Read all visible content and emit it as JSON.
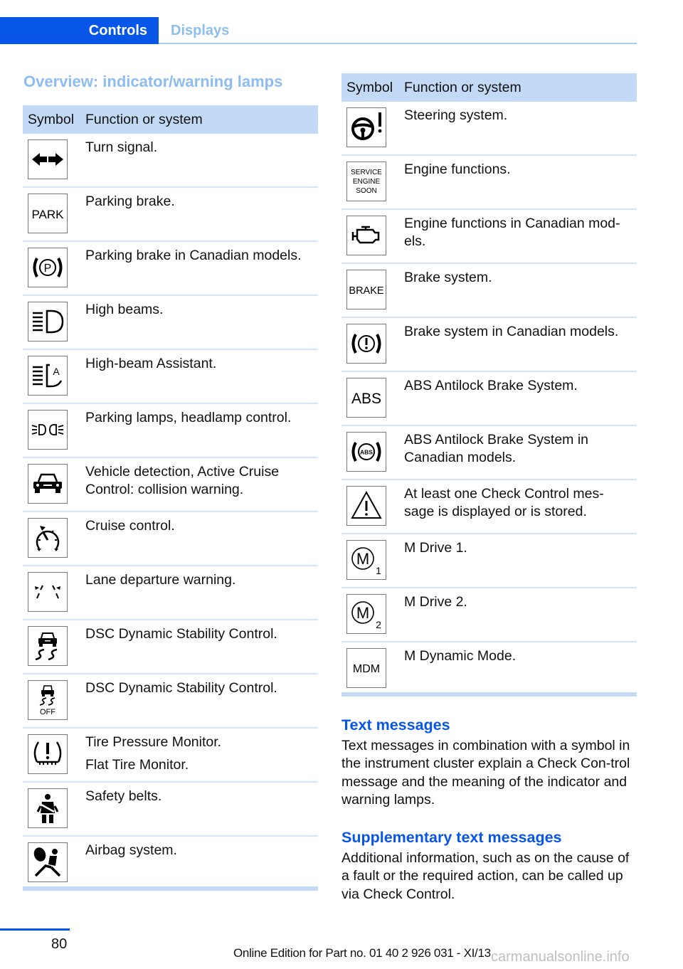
{
  "tabs": [
    {
      "label": "Controls",
      "active": true
    },
    {
      "label": "Displays",
      "active": false
    }
  ],
  "section_title": "Overview: indicator/warning lamps",
  "table_headers": {
    "symbol": "Symbol",
    "function": "Function or system"
  },
  "left_rows": [
    {
      "icon": "turn-signal-icon",
      "lines": [
        "Turn signal."
      ]
    },
    {
      "icon": "park-text-icon",
      "lines": [
        "Parking brake."
      ]
    },
    {
      "icon": "parking-brake-canada-icon",
      "lines": [
        "Parking brake in Canadian models."
      ]
    },
    {
      "icon": "high-beam-icon",
      "lines": [
        "High beams."
      ]
    },
    {
      "icon": "high-beam-assistant-icon",
      "lines": [
        "High-beam Assistant."
      ]
    },
    {
      "icon": "parking-lamps-icon",
      "lines": [
        "Parking lamps, headlamp control."
      ]
    },
    {
      "icon": "collision-warning-car-icon",
      "lines": [
        "Vehicle detection, Active Cruise Control: collision warning."
      ]
    },
    {
      "icon": "cruise-control-icon",
      "lines": [
        "Cruise control."
      ]
    },
    {
      "icon": "lane-departure-icon",
      "lines": [
        "Lane departure warning."
      ]
    },
    {
      "icon": "dsc-icon",
      "lines": [
        "DSC Dynamic Stability Control."
      ]
    },
    {
      "icon": "dsc-off-icon",
      "lines": [
        "DSC Dynamic Stability Control."
      ]
    },
    {
      "icon": "tire-pressure-icon",
      "lines": [
        "Tire Pressure Monitor.",
        "Flat Tire Monitor."
      ]
    },
    {
      "icon": "seat-belt-icon",
      "lines": [
        "Safety belts."
      ]
    },
    {
      "icon": "airbag-icon",
      "lines": [
        "Airbag system."
      ]
    }
  ],
  "right_rows": [
    {
      "icon": "steering-warning-icon",
      "lines": [
        "Steering system."
      ]
    },
    {
      "icon": "service-engine-soon-icon",
      "lines": [
        "Engine functions."
      ]
    },
    {
      "icon": "engine-check-icon",
      "lines": [
        "Engine functions in Canadian mod-els."
      ]
    },
    {
      "icon": "brake-text-icon",
      "lines": [
        "Brake system."
      ]
    },
    {
      "icon": "brake-canada-icon",
      "lines": [
        "Brake system in Canadian models."
      ]
    },
    {
      "icon": "abs-text-icon",
      "lines": [
        "ABS Antilock Brake System."
      ]
    },
    {
      "icon": "abs-canada-icon",
      "lines": [
        "ABS Antilock Brake System in Canadian models."
      ]
    },
    {
      "icon": "warning-triangle-icon",
      "lines": [
        "At least one Check Control mes-sage is displayed or is stored."
      ]
    },
    {
      "icon": "m-drive-1-icon",
      "lines": [
        "M Drive 1."
      ]
    },
    {
      "icon": "m-drive-2-icon",
      "lines": [
        "M Drive 2."
      ]
    },
    {
      "icon": "mdm-icon",
      "lines": [
        "M Dynamic Mode."
      ]
    }
  ],
  "icon_labels": {
    "park": "PARK",
    "brake": "BRAKE",
    "abs": "ABS",
    "abs_small": "ABS",
    "mdm": "MDM",
    "off": "OFF",
    "service": [
      "SERVICE",
      "ENGINE",
      "SOON"
    ],
    "p": "P",
    "a": "A",
    "m": "M",
    "sub1": "1",
    "sub2": "2"
  },
  "text_messages": {
    "title": "Text messages",
    "body": "Text messages in combination with a symbol in the instrument cluster explain a Check Con-trol message and the meaning of the indicator and warning lamps."
  },
  "supplementary": {
    "title": "Supplementary text messages",
    "body": "Additional information, such as on the cause of a fault or the required action, can be called up via Check Control."
  },
  "footer": {
    "page_number": "80",
    "edition": "Online Edition for Part no. 01 40 2 926 031 - XI/13",
    "watermark": "carmanualsonline.info"
  }
}
